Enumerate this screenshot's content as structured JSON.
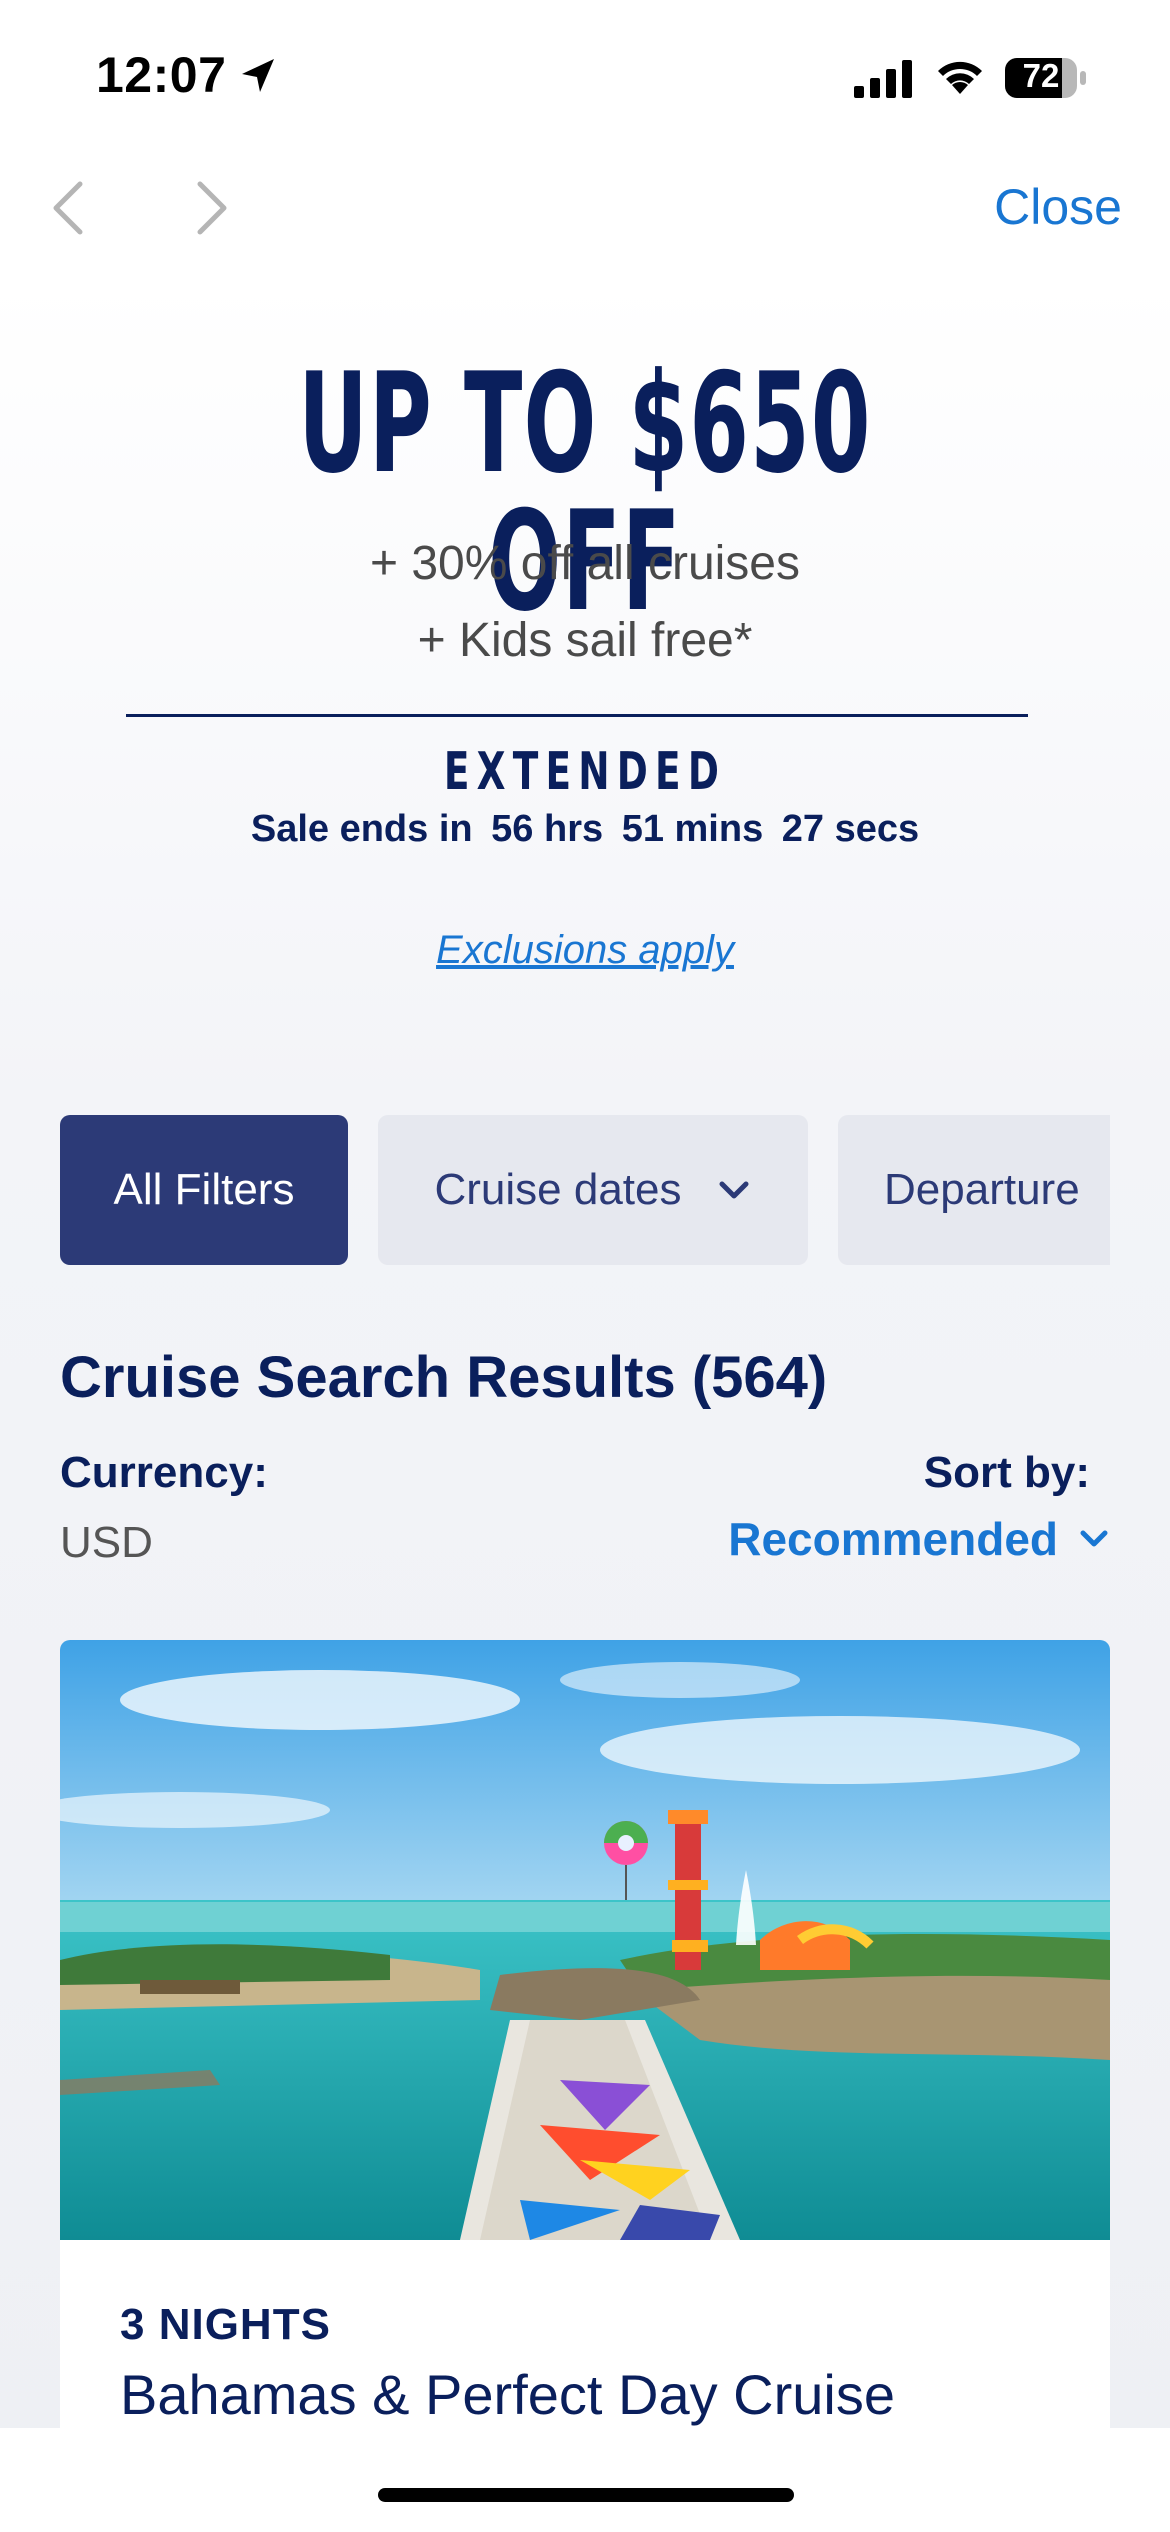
{
  "status_bar": {
    "time": "12:07",
    "battery": "72",
    "icons": [
      "location-arrow-icon",
      "cell-signal-icon",
      "wifi-icon",
      "battery-icon"
    ]
  },
  "nav": {
    "close_label": "Close",
    "icons": [
      "chevron-left-icon",
      "chevron-right-icon"
    ]
  },
  "promo": {
    "headline": "UP TO $650 OFF",
    "line1": "+ 30% off all cruises",
    "line2": "+ Kids sail free*",
    "extended": "EXTENDED",
    "sale_ends_prefix": "Sale ends in",
    "hours": "56 hrs",
    "mins": "51 mins",
    "secs": "27 secs",
    "exclusions": "Exclusions apply"
  },
  "filters": {
    "all": "All Filters",
    "dates": "Cruise dates",
    "departure": "Departure"
  },
  "results": {
    "title": "Cruise Search Results (564)",
    "currency_label": "Currency:",
    "currency_value": "USD",
    "sort_label": "Sort by:",
    "sort_value": "Recommended"
  },
  "card": {
    "nights": "3 NIGHTS",
    "title": "Bahamas & Perfect Day Cruise",
    "image_icon": "island-photo"
  },
  "colors": {
    "navy": "#0a1f5c",
    "link_blue": "#1976d2",
    "filter_active": "#2c3a77",
    "filter_inactive": "#e6e8ef"
  }
}
